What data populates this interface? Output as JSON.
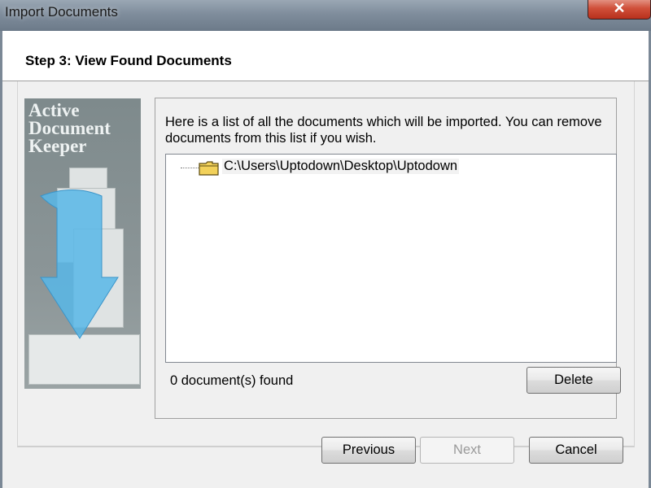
{
  "window": {
    "title": "Import Documents",
    "close_glyph": "✕"
  },
  "header": {
    "step_title": "Step 3: View Found Documents"
  },
  "side_image": {
    "title_lines": "Active\nDocument\nKeeper",
    "arrow_color": "#4fb3e6"
  },
  "main": {
    "description": "Here is a list of all the documents which will be imported. You can  remove documents from this list if you wish.",
    "tree": [
      {
        "label": "C:\\Users\\Uptodown\\Desktop\\Uptodown",
        "icon": "folder-icon"
      }
    ],
    "status": "0 document(s) found",
    "delete_label": "Delete"
  },
  "footer": {
    "previous_label": "Previous",
    "next_label": "Next",
    "cancel_label": "Cancel",
    "next_disabled": true
  }
}
